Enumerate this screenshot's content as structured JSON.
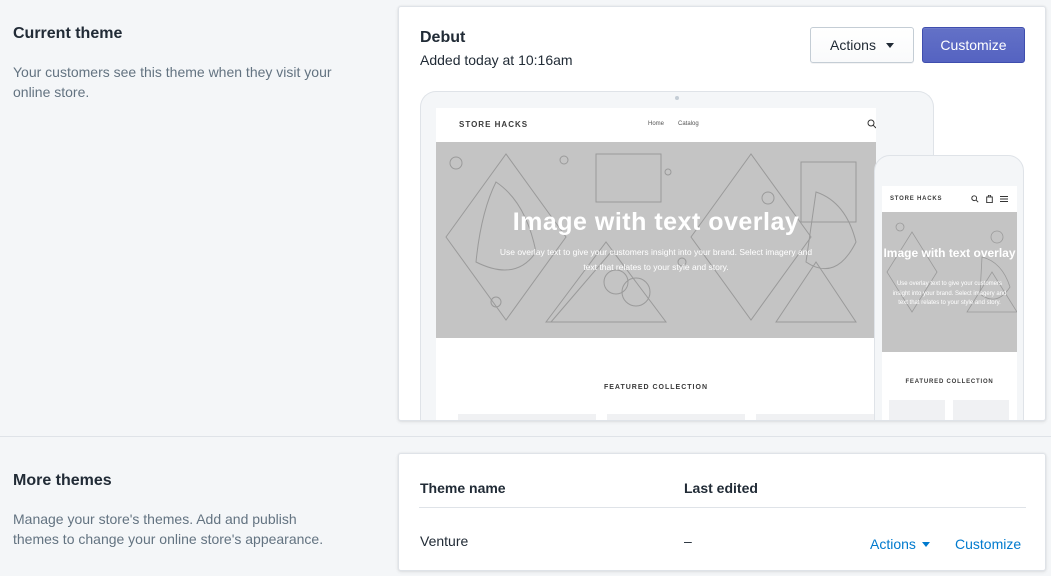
{
  "current_theme": {
    "heading": "Current theme",
    "description": "Your customers see this theme when they visit your online store.",
    "theme": {
      "name": "Debut",
      "added": "Added today at 10:16am",
      "actions_label": "Actions",
      "customize_label": "Customize"
    },
    "preview": {
      "store_name": "STORE HACKS",
      "nav_links": [
        "Home",
        "Catalog"
      ],
      "hero_title": "Image with text overlay",
      "hero_text": "Use overlay text to give your customers insight into your brand. Select imagery and text that relates to your style and story.",
      "featured_heading": "FEATURED COLLECTION"
    }
  },
  "more_themes": {
    "heading": "More themes",
    "description": "Manage your store's themes. Add and publish themes to change your online store's appearance.",
    "columns": [
      "Theme name",
      "Last edited"
    ],
    "rows": [
      {
        "name": "Venture",
        "last_edited": "–",
        "actions_label": "Actions",
        "customize_label": "Customize"
      }
    ]
  },
  "colors": {
    "primary": "#5c6ac4",
    "link": "#007ace",
    "background": "#f4f6f8"
  },
  "icons": [
    "chevron-down-icon",
    "search-icon",
    "cart-icon",
    "menu-icon"
  ]
}
